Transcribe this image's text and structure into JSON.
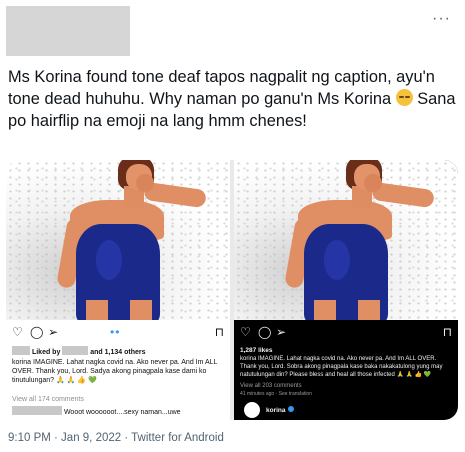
{
  "tweet": {
    "more_icon": "more-icon",
    "text_1": "Ms Korina found tone deaf tapos nagpalit ng caption, ayu'n tone dead huhuhu. Why naman po ganu'n Ms Korina",
    "text_2": "Sana po hairflip na emoji na lang hmm chenes!",
    "emoji_icon": "pensive-face-emoji",
    "meta": "9:10 PM · Jan 9, 2022 · Twitter for Android"
  },
  "left_post": {
    "liked_by": "Liked by",
    "liked_and": "and 1,134 others",
    "caption": "korina IMAGINE. Lahat nagka covid na. Ako never pa. And Im ALL OVER. Thank you, Lord. Sadya akong pinagpala kase dami ko tinutulungan? 🙏 🙏 👍 💚",
    "view_comments": "View all 174 comments",
    "comment": "Wooot woooooot....sexy naman...uwe"
  },
  "right_post": {
    "likes": "1,287 likes",
    "caption": "korina IMAGINE. Lahat nagka covid na. Ako never pa. And Im ALL OVER. Thank you, Lord. Sobra akong pinagpala kase baka nakakatulong yung may natutulungan din? Please bless and heal all those infected 🙏 🙏 👍 💚",
    "view_comments": "View all 203 comments",
    "time": "41 minutes ago · See translation",
    "username": "korina"
  },
  "colors": {
    "text": "#0f1419",
    "muted": "#536471",
    "swimsuit": "#1b2a8a",
    "ig_blue": "#3897f0"
  }
}
